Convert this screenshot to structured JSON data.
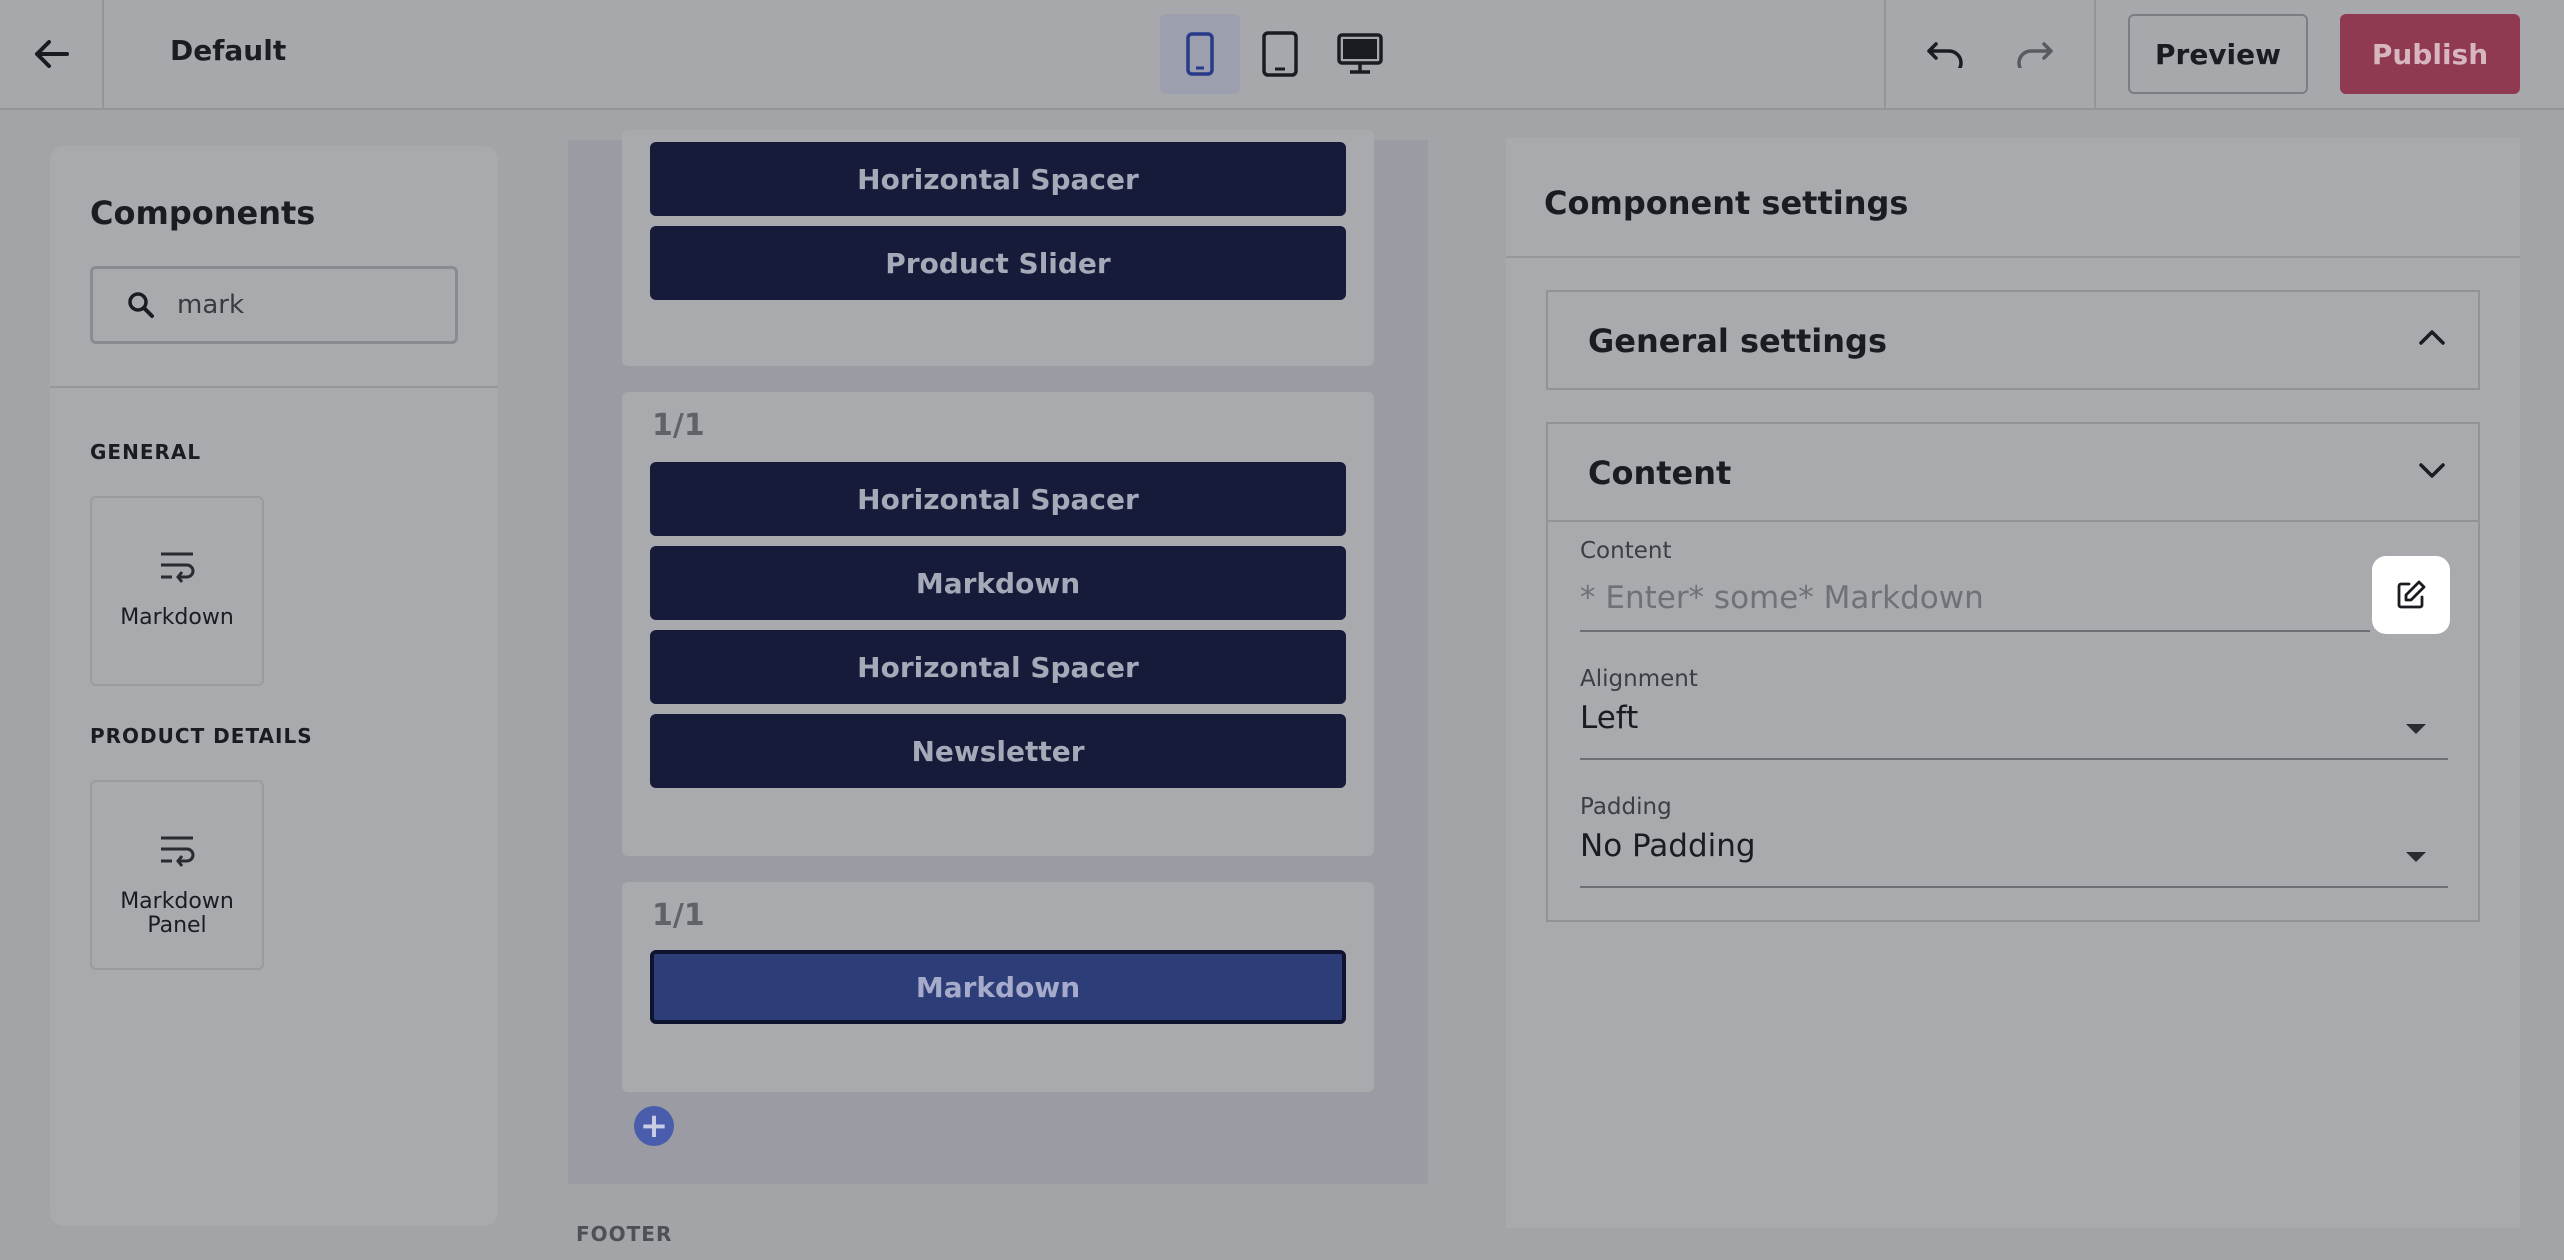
{
  "header": {
    "title": "Default",
    "preview_label": "Preview",
    "publish_label": "Publish"
  },
  "sidebar": {
    "title": "Components",
    "search": {
      "value": "mark",
      "placeholder": ""
    },
    "sections": [
      {
        "label": "GENERAL",
        "items": [
          {
            "label": "Markdown"
          }
        ]
      },
      {
        "label": "PRODUCT DETAILS",
        "items": [
          {
            "label": "Markdown Panel"
          }
        ]
      }
    ]
  },
  "canvas": {
    "sections": [
      {
        "column_label": "",
        "blocks": [
          "Horizontal Spacer",
          "Product Slider"
        ]
      },
      {
        "column_label": "1/1",
        "blocks": [
          "Horizontal Spacer",
          "Markdown",
          "Horizontal Spacer",
          "Newsletter"
        ]
      },
      {
        "column_label": "1/1",
        "blocks": [
          "Markdown"
        ],
        "selected_index": 0
      }
    ],
    "footer_label": "FOOTER"
  },
  "settings": {
    "title": "Component settings",
    "general_label": "General settings",
    "content_label": "Content",
    "fields": {
      "content": {
        "label": "Content",
        "value": "",
        "placeholder": "* Enter* some* Markdown"
      },
      "alignment": {
        "label": "Alignment",
        "value": "Left"
      },
      "padding": {
        "label": "Padding",
        "value": "No Padding"
      }
    }
  },
  "colors": {
    "selected_block": "#2c3d78",
    "block": "#151b39",
    "publish": "#8f3a51"
  }
}
